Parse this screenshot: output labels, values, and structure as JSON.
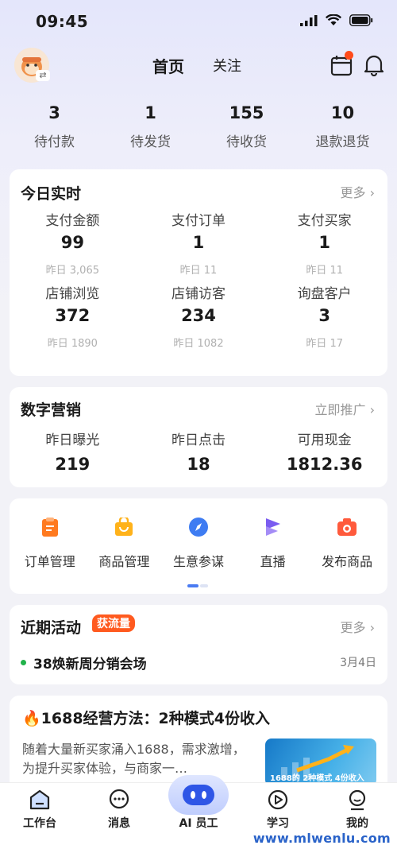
{
  "status_bar": {
    "time": "09:45"
  },
  "header": {
    "tab_home": "首页",
    "tab_follow": "关注"
  },
  "order_stats": [
    {
      "value": "3",
      "label": "待付款"
    },
    {
      "value": "1",
      "label": "待发货"
    },
    {
      "value": "155",
      "label": "待收货"
    },
    {
      "value": "10",
      "label": "退款退货"
    }
  ],
  "realtime": {
    "title": "今日实时",
    "more": "更多",
    "cells": [
      {
        "label": "支付金额",
        "value": "99",
        "yesterday": "昨日 3,065"
      },
      {
        "label": "支付订单",
        "value": "1",
        "yesterday": "昨日 11"
      },
      {
        "label": "支付买家",
        "value": "1",
        "yesterday": "昨日 11"
      },
      {
        "label": "店铺浏览",
        "value": "372",
        "yesterday": "昨日 1890"
      },
      {
        "label": "店铺访客",
        "value": "234",
        "yesterday": "昨日 1082"
      },
      {
        "label": "询盘客户",
        "value": "3",
        "yesterday": "昨日 17"
      }
    ]
  },
  "marketing": {
    "title": "数字营销",
    "more": "立即推广",
    "cells": [
      {
        "label": "昨日曝光",
        "value": "219"
      },
      {
        "label": "昨日点击",
        "value": "18"
      },
      {
        "label": "可用现金",
        "value": "1812.36"
      }
    ]
  },
  "tools": [
    {
      "label": "订单管理",
      "icon": "order-icon"
    },
    {
      "label": "商品管理",
      "icon": "shopping-bag-icon"
    },
    {
      "label": "生意参谋",
      "icon": "compass-icon"
    },
    {
      "label": "直播",
      "icon": "live-icon"
    },
    {
      "label": "发布商品",
      "icon": "camera-icon"
    }
  ],
  "activities": {
    "title": "近期活动",
    "badge": "获流量",
    "more": "更多",
    "item_text": "38焕新周分销会场",
    "item_date": "3月4日"
  },
  "article": {
    "title": "1688经营方法：2种模式4份收入",
    "body": "随着大量新买家涌入1688，需求激增，为提升买家体验，与商家一…",
    "image_text": "1688的 2种模式 4份收入"
  },
  "bottom_nav": [
    {
      "label": "工作台",
      "icon": "workbench-icon"
    },
    {
      "label": "消息",
      "icon": "message-icon"
    },
    {
      "label": "AI 员工",
      "icon": "ai-robot-icon"
    },
    {
      "label": "学习",
      "icon": "play-icon"
    },
    {
      "label": "我的",
      "icon": "profile-icon"
    }
  ],
  "watermark": "www.mlwenlu.com",
  "colors": {
    "accent_orange": "#ff5a1f",
    "accent_blue": "#4a7bf2",
    "green_dot": "#21b24a"
  }
}
